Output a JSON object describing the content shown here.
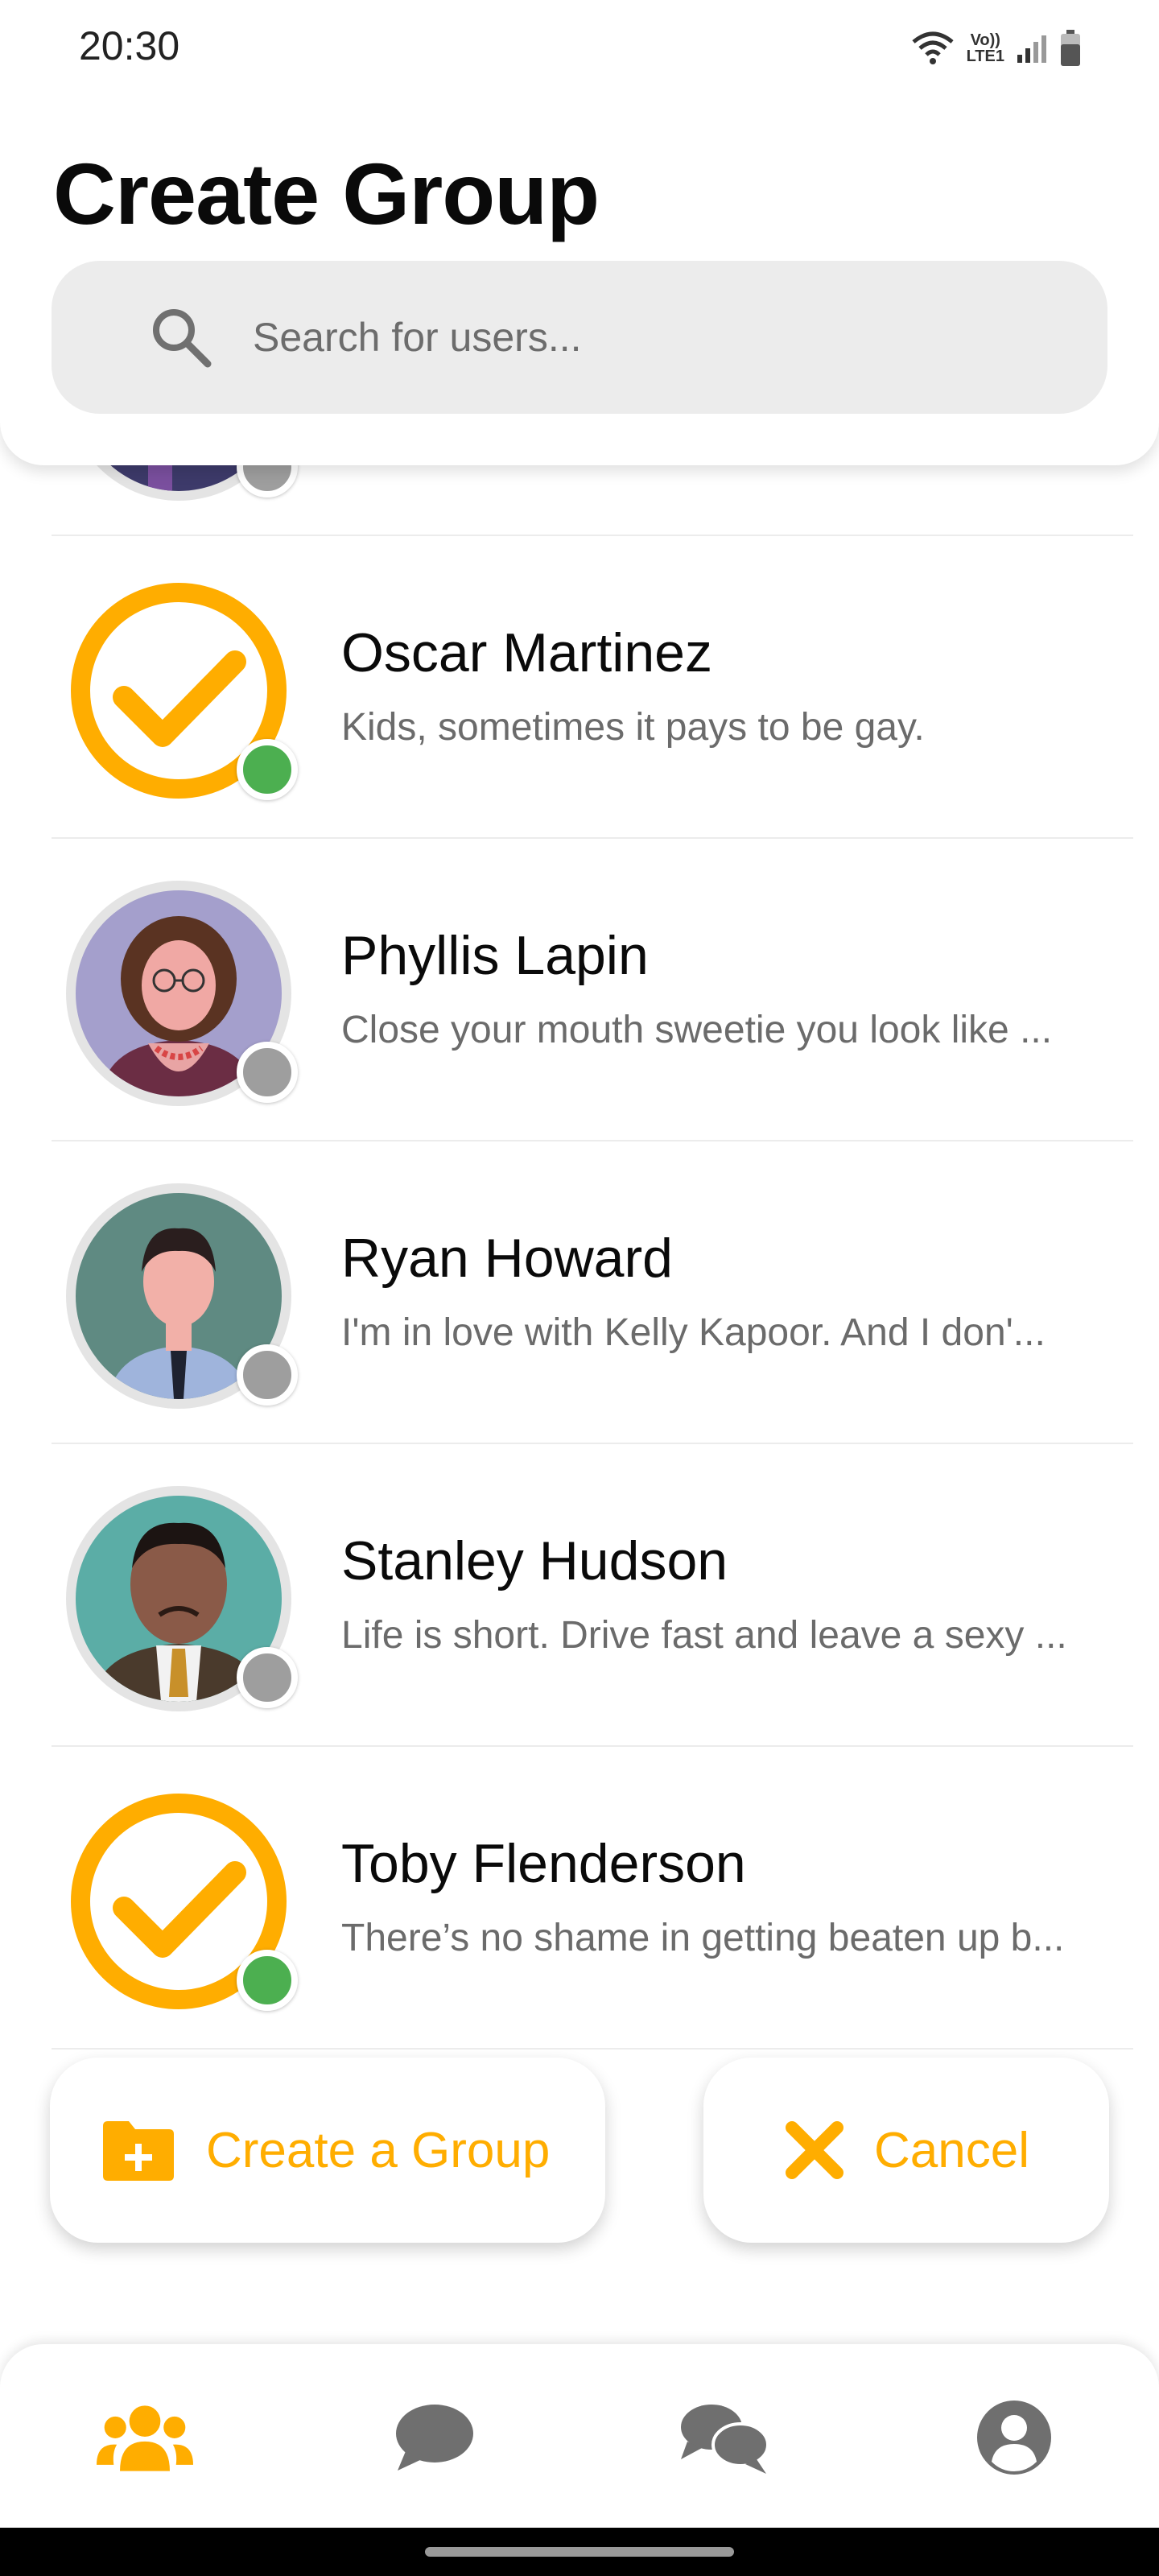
{
  "status_bar": {
    "time": "20:30",
    "network_label_top": "Vo))",
    "network_label_bottom": "LTE1",
    "icons": [
      "wifi-icon",
      "signal-icon",
      "battery-icon"
    ]
  },
  "header": {
    "title": "Create Group",
    "search_placeholder": "Search for users..."
  },
  "users": [
    {
      "name": "",
      "status": "",
      "avatar": "purple-figure",
      "selected": false,
      "online": false
    },
    {
      "name": "Oscar Martinez",
      "status": "Kids, sometimes it pays to be gay.",
      "avatar": "check-mark",
      "selected": true,
      "online": true
    },
    {
      "name": "Phyllis Lapin",
      "status": "Close your mouth sweetie you look like ...",
      "avatar": "phyllis-portrait",
      "selected": false,
      "online": false
    },
    {
      "name": "Ryan Howard",
      "status": "I'm in love with Kelly Kapoor. And I don'...",
      "avatar": "ryan-portrait",
      "selected": false,
      "online": false
    },
    {
      "name": "Stanley Hudson",
      "status": "Life is short. Drive fast and leave a sexy ...",
      "avatar": "stanley-portrait",
      "selected": false,
      "online": false
    },
    {
      "name": "Toby Flenderson",
      "status": "There’s no shame in getting beaten up b...",
      "avatar": "check-mark",
      "selected": true,
      "online": true
    }
  ],
  "actions": {
    "create_label": "Create a Group",
    "cancel_label": "Cancel"
  },
  "bottom_nav": {
    "items": [
      "users-icon",
      "chat-icon",
      "group-chat-icon",
      "profile-icon"
    ],
    "active_index": 0
  },
  "colors": {
    "accent": "#ffad00",
    "online": "#4caf50",
    "offline": "#9e9e9e",
    "nav_inactive": "#6f6f6f"
  }
}
